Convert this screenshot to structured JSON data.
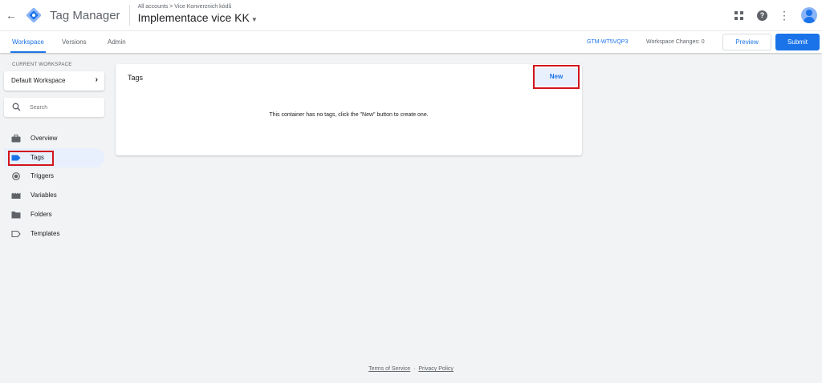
{
  "header": {
    "app_title": "Tag Manager",
    "breadcrumb": "All accounts > Vice Konverznich kódů",
    "container_name": "Implementace vice KK",
    "icons": [
      "back-arrow-icon",
      "apps-grid-icon",
      "help-icon",
      "more-vert-icon",
      "account-avatar-icon"
    ]
  },
  "nav": {
    "tabs": [
      {
        "label": "Workspace",
        "active": true
      },
      {
        "label": "Versions",
        "active": false
      },
      {
        "label": "Admin",
        "active": false
      }
    ],
    "container_id": "GTM-WT5VQP3",
    "workspace_changes": "Workspace Changes: 0",
    "preview_label": "Preview",
    "submit_label": "Submit"
  },
  "sidebar": {
    "current_workspace_label": "CURRENT WORKSPACE",
    "workspace_name": "Default Workspace",
    "search_placeholder": "Search",
    "items": [
      {
        "label": "Overview",
        "icon": "briefcase-icon",
        "active": false
      },
      {
        "label": "Tags",
        "icon": "tag-icon",
        "active": true
      },
      {
        "label": "Triggers",
        "icon": "trigger-icon",
        "active": false
      },
      {
        "label": "Variables",
        "icon": "variables-icon",
        "active": false
      },
      {
        "label": "Folders",
        "icon": "folder-icon",
        "active": false
      },
      {
        "label": "Templates",
        "icon": "template-icon",
        "active": false
      }
    ]
  },
  "main": {
    "card_title": "Tags",
    "new_button_label": "New",
    "empty_message": "This container has no tags, click the \"New\" button to create one."
  },
  "footer": {
    "terms": "Terms of Service",
    "separator": "·",
    "privacy": "Privacy Policy"
  },
  "colors": {
    "accent": "#1a73e8",
    "highlight_box": "#d3141e",
    "background": "#f1f3f4",
    "active_nav_bg": "#e8f0fe"
  }
}
